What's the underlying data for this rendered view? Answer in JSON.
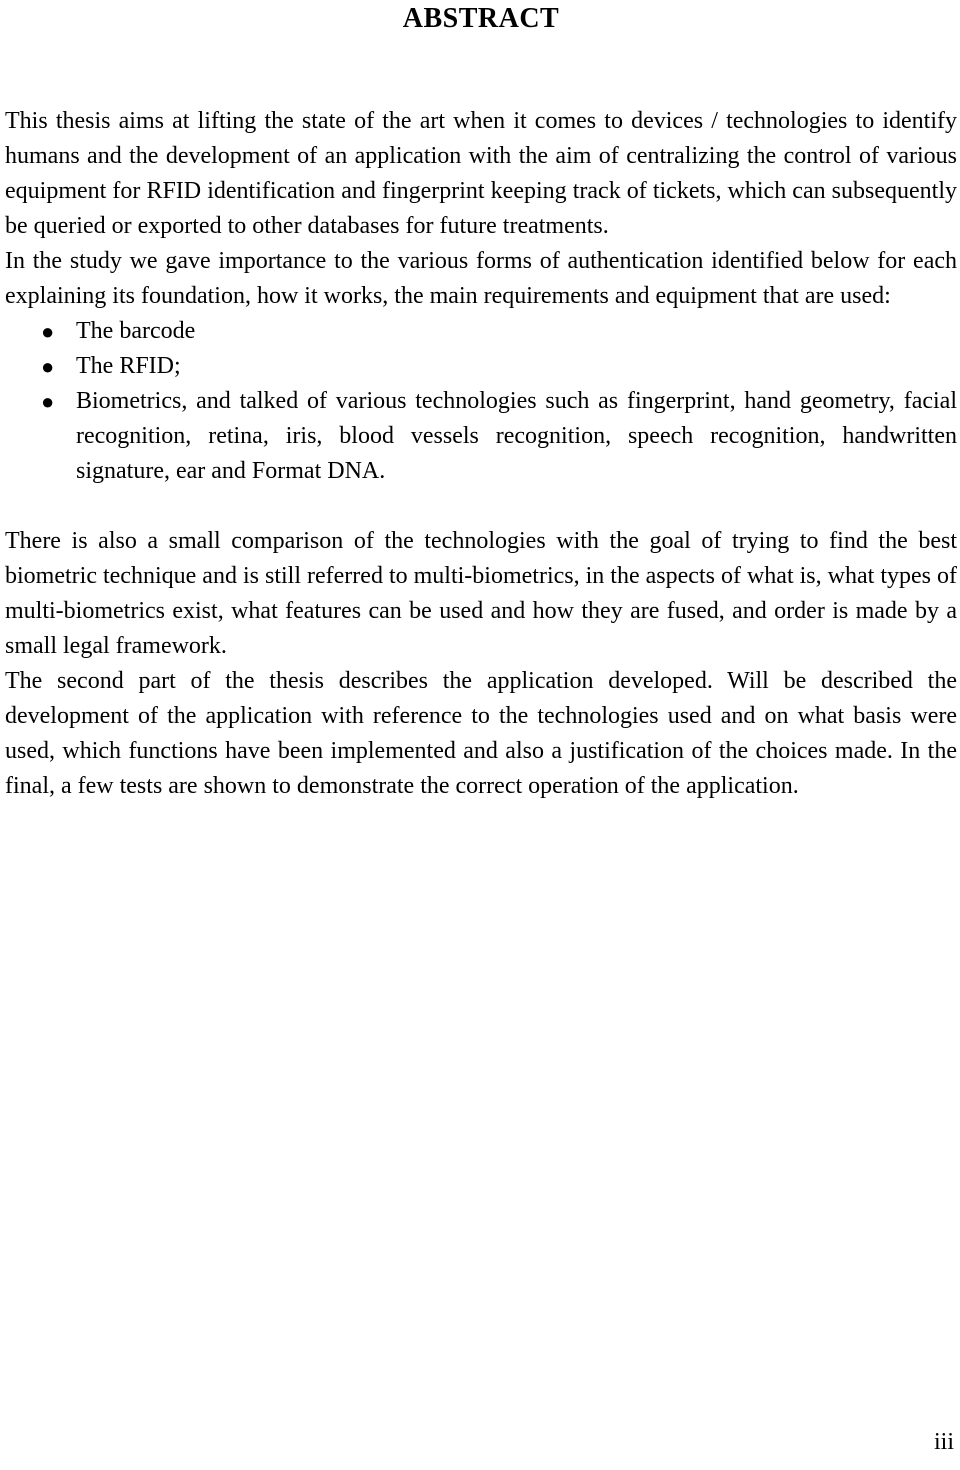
{
  "document": {
    "title": "ABSTRACT",
    "page_number": "iii",
    "paragraphs": [
      {
        "id": "intro",
        "text": "This thesis aims at lifting the state of the art when it comes to devices / technologies to identify humans and the development of an application with the aim of centralizing the control of various equipment for RFID identification and fingerprint keeping track of tickets, which can subsequently be queried or exported to other databases for future treatments."
      },
      {
        "id": "study-lead-in",
        "text": "In the study we gave importance to the various forms of authentication identified below for each explaining its foundation, how it works, the main requirements and equipment that are used:"
      }
    ],
    "bullet_marker": "●",
    "bullets": [
      {
        "id": "barcode",
        "text": "The barcode"
      },
      {
        "id": "rfid",
        "text": "The RFID;"
      },
      {
        "id": "biometrics",
        "text": "Biometrics, and talked of various technologies such as fingerprint, hand geometry, facial recognition, retina, iris, blood vessels recognition, speech recognition, handwritten signature, ear and Format DNA."
      }
    ],
    "paragraphs_after": [
      {
        "id": "comparison",
        "text": "There is also a small comparison of the technologies with the goal of trying to find the best biometric technique and is still referred to multi-biometrics, in the aspects of what is, what types of multi-biometrics exist, what features can be used and how they are fused, and order is made by a small legal framework."
      },
      {
        "id": "second-part",
        "text": "The second part of the thesis describes the application developed. Will be described the development of the application with reference to the technologies used and on what basis were used, which functions have been implemented and also a justification of the choices made. In the final, a few tests are shown to demonstrate the correct operation of the application."
      }
    ]
  }
}
